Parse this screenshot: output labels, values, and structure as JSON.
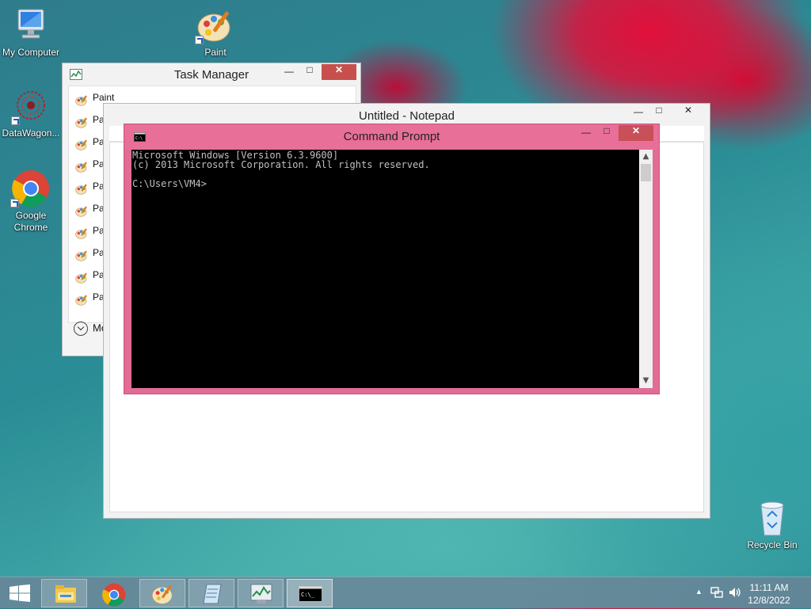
{
  "desktop": {
    "icons": [
      {
        "label": "My Computer",
        "icon": "computer-icon"
      },
      {
        "label": "Paint",
        "icon": "paint-icon"
      },
      {
        "label": "DataWagon...",
        "icon": "datawagon-icon"
      },
      {
        "label": "Google Chrome",
        "icon": "chrome-icon"
      },
      {
        "label": "Recycle Bin",
        "icon": "recycle-bin-icon"
      }
    ]
  },
  "task_manager": {
    "title": "Task Manager",
    "processes": [
      "Paint",
      "Paint",
      "Paint",
      "Paint",
      "Paint",
      "Paint",
      "Paint",
      "Paint",
      "Paint",
      "Paint"
    ],
    "more_details": "More d"
  },
  "notepad": {
    "title": "Untitled - Notepad"
  },
  "command_prompt": {
    "title": "Command Prompt",
    "console_lines": [
      "Microsoft Windows [Version 6.3.9600]",
      "(c) 2013 Microsoft Corporation. All rights reserved.",
      "",
      "C:\\Users\\VM4>"
    ]
  },
  "window_controls": {
    "minimize": "—",
    "maximize": "□",
    "close": "✕"
  },
  "taskbar": {
    "items": [
      "start-button",
      "file-explorer",
      "google-chrome",
      "paint",
      "notepad",
      "task-manager",
      "command-prompt"
    ],
    "active": "command-prompt",
    "tray": {
      "time": "11:11 AM",
      "date": "12/8/2022"
    }
  },
  "colors": {
    "cmd_frame": "#e16d96",
    "close_button": "#c7504c",
    "console_bg": "#000000",
    "console_text": "#c0c0c0"
  }
}
